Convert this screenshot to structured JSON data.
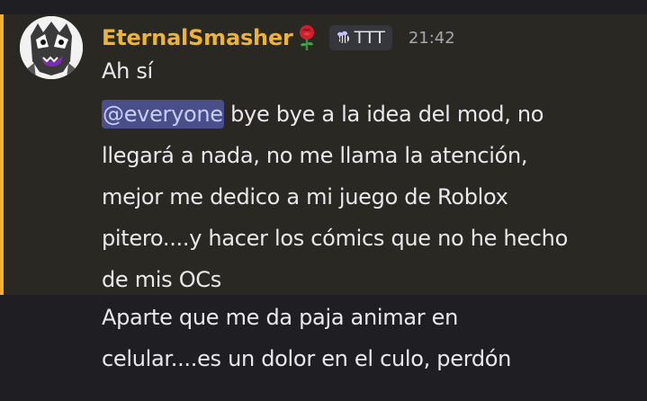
{
  "author": {
    "username": "EternalSmasher",
    "username_color": "#f0b232",
    "name_icon": "rose-icon",
    "tag": {
      "icon": "bee-icon",
      "label": "TTT"
    },
    "timestamp": "21:42"
  },
  "messages": [
    {
      "lines": [
        "Ah sí"
      ]
    },
    {
      "mention": "@everyone",
      "lines": [
        "bye bye a la idea del mod, no",
        "llegará a nada, no me llama la atención,",
        "mejor me dedico a mi juego de Roblox",
        "pitero....y hacer los cómics que no he hecho",
        "de mis OCs"
      ],
      "highlighted": true,
      "highlight_color": "#f0b232"
    },
    {
      "lines": [
        "Aparte que me da paja animar en",
        "celular....es un dolor en el culo, perdón"
      ]
    }
  ]
}
